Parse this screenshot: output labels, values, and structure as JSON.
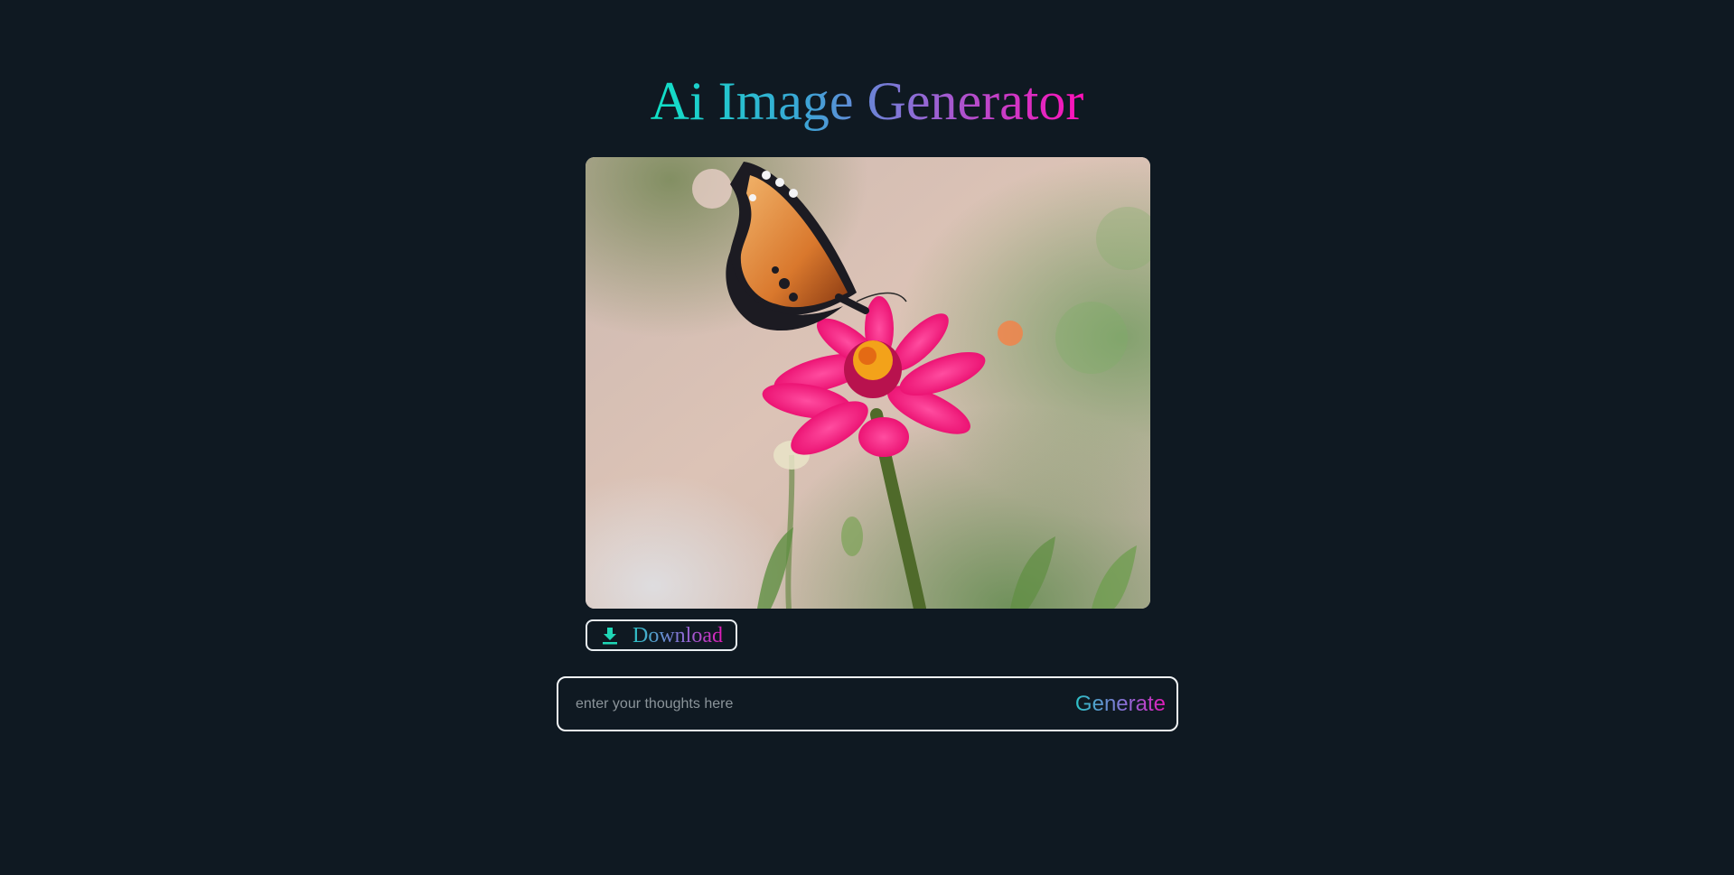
{
  "header": {
    "title": "Ai Image Generator"
  },
  "image": {
    "alt": ""
  },
  "actions": {
    "download_label": "Download",
    "download_icon": "download-icon"
  },
  "prompt": {
    "placeholder": "enter your thoughts here",
    "value": "",
    "generate_label": "Generate"
  },
  "colors": {
    "background": "#0f1922",
    "gradient_start": "#0fe3c6",
    "gradient_mid": "#8a6fd6",
    "gradient_end": "#ff10b8",
    "border": "#f2f5f7"
  }
}
